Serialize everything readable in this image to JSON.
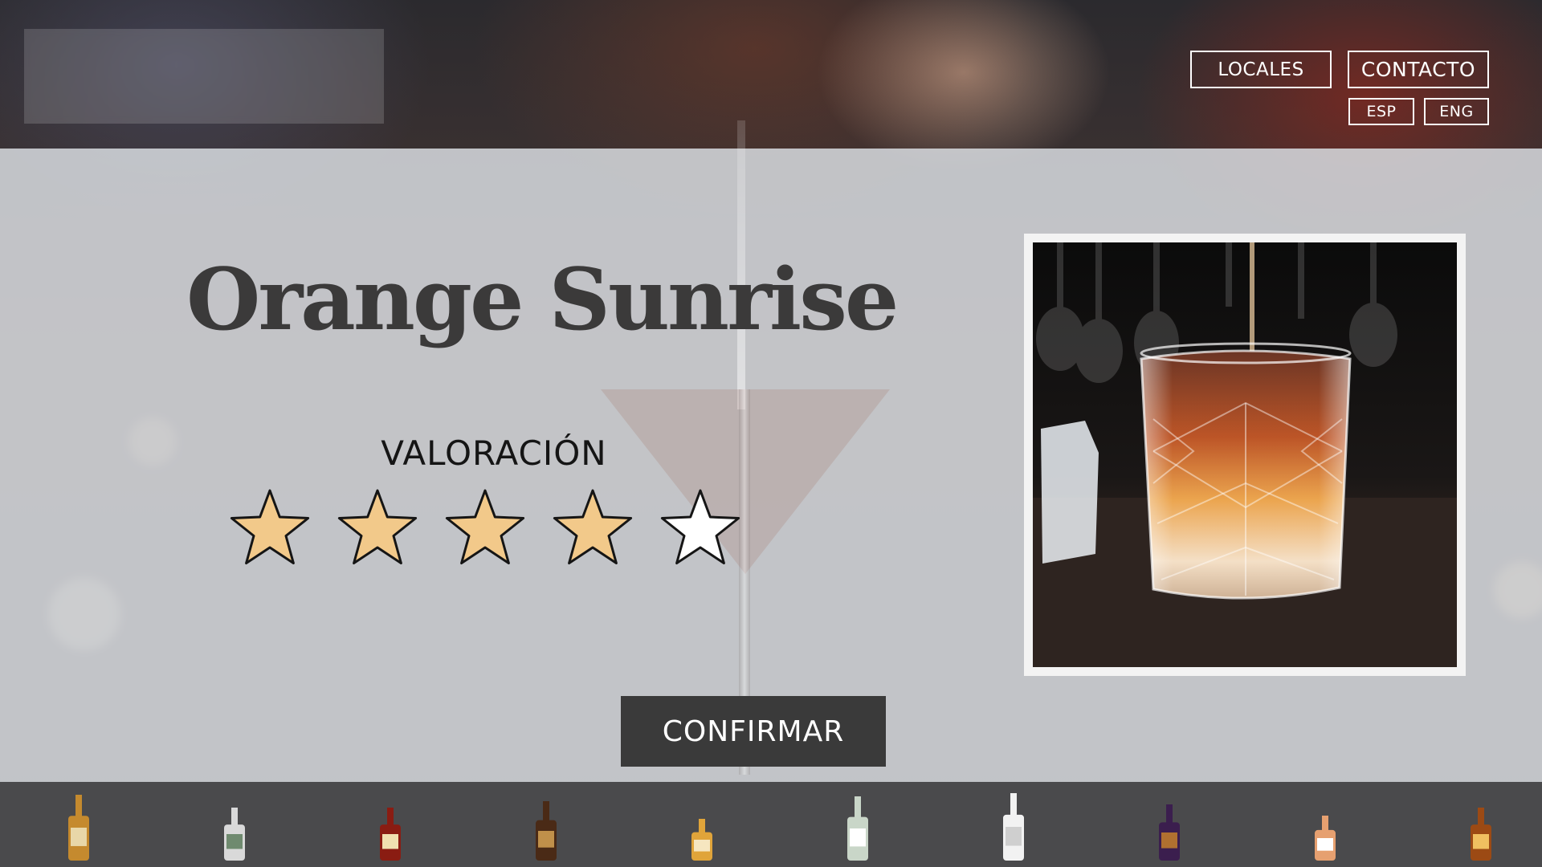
{
  "header": {
    "logo": "",
    "nav": [
      {
        "label": "LOCALES"
      },
      {
        "label": "CONTACTO"
      }
    ],
    "languages": [
      {
        "label": "ESP"
      },
      {
        "label": "ENG"
      }
    ]
  },
  "main": {
    "title": "Orange Sunrise",
    "rating_label": "VALORACIÓN",
    "rating": {
      "value": 4,
      "max": 5
    },
    "confirm_label": "CONFIRMAR"
  },
  "colors": {
    "star_fill": "#F2C98A",
    "star_empty": "#FFFFFF",
    "star_stroke": "#151515",
    "button_bg": "#3A3A3A",
    "footer_bg": "#4A4A4C"
  },
  "footer": {
    "bottles": [
      "whisky-bottle-icon",
      "gin-bottle-icon",
      "bourbon-bottle-icon",
      "rum-bottle-icon",
      "scotch-bottle-icon",
      "whisky-bottle-icon",
      "vodka-bottle-icon",
      "cognac-bottle-icon",
      "japanese-whisky-bottle-icon",
      "brandy-bottle-icon"
    ]
  }
}
